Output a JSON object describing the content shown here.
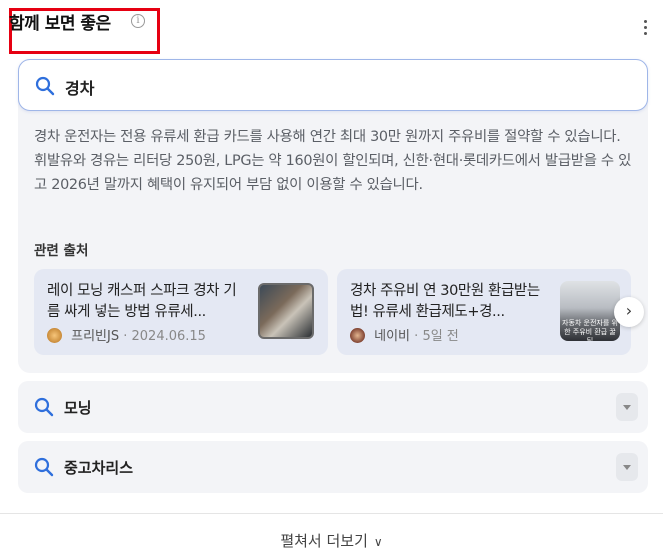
{
  "header": {
    "title": "함께 보면 좋은",
    "info_icon": "info-icon",
    "more_icon": "more-vertical-icon",
    "highlight_color": "#e60012"
  },
  "main_query": {
    "text": "경차",
    "icon": "search-icon",
    "accent_color": "#2f6fdc"
  },
  "answer": "경차 운전자는 전용 유류세 환급 카드를 사용해 연간 최대 30만 원까지 주유비를 절약할 수 있습니다. 휘발유와 경유는 리터당 250원, LPG는 약 160원이 할인되며, 신한·현대·롯데카드에서 발급받을 수 있고 2026년 말까지 혜택이 유지되어 부담 없이 이용할 수 있습니다.",
  "sources": {
    "label": "관련 출처",
    "items": [
      {
        "title": "레이 모닝 캐스퍼 스파크 경차 기름 싸게 넣는 방법 유류세...",
        "author": "프리빈JS",
        "date": "2024.06.15"
      },
      {
        "title": "경차 주유비 연 30만원 환급받는 법! 유류세 환급제도+경...",
        "author": "네이비",
        "date": "5일 전",
        "thumb_text": "자동차 운전자를 위한 주유비 환급 꿀팁"
      }
    ],
    "next_icon": "chevron-right-icon"
  },
  "related_queries": [
    {
      "text": "모닝"
    },
    {
      "text": "중고차리스"
    }
  ],
  "expand": {
    "label": "펼쳐서 더보기",
    "icon": "chevron-down-icon"
  }
}
